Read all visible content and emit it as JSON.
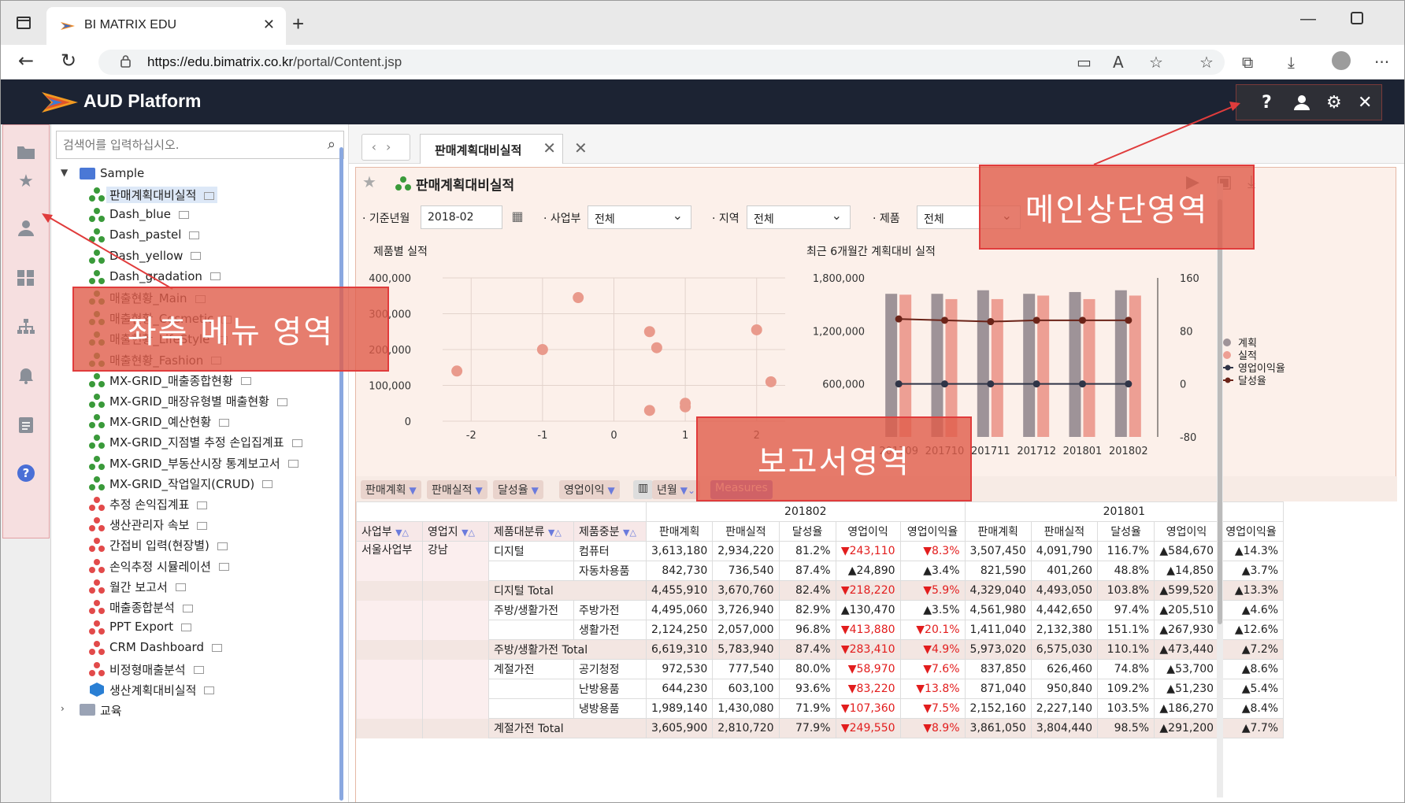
{
  "browser": {
    "tab_title": "BI MATRIX EDU",
    "url_host": "https://edu.bimatrix.co.kr",
    "url_path": "/portal/Content.jsp"
  },
  "app": {
    "name": "AUD Platform",
    "header_tools": [
      "help-icon",
      "user-icon",
      "gear-icon",
      "close-icon"
    ]
  },
  "sidebar_icons": [
    "folder-icon",
    "star-icon",
    "user-icon",
    "dashboard-icon",
    "org-chart-icon",
    "alarm-icon",
    "clipboard-icon",
    "help-icon"
  ],
  "search": {
    "placeholder": "검색어를 입력하십시오."
  },
  "tree": {
    "root": "Sample",
    "items": [
      {
        "label": "판매계획대비실적",
        "type": "green"
      },
      {
        "label": "Dash_blue",
        "type": "green"
      },
      {
        "label": "Dash_pastel",
        "type": "green"
      },
      {
        "label": "Dash_yellow",
        "type": "green"
      },
      {
        "label": "Dash_gradation",
        "type": "green"
      },
      {
        "label": "매출현황_Main",
        "type": "green"
      },
      {
        "label": "매출현황_Cosmetic",
        "type": "green"
      },
      {
        "label": "매출현황_LifeStyle",
        "type": "green"
      },
      {
        "label": "매출현황_Fashion",
        "type": "green"
      },
      {
        "label": "MX-GRID_매출종합현황",
        "type": "green"
      },
      {
        "label": "MX-GRID_매장유형별 매출현황",
        "type": "green"
      },
      {
        "label": "MX-GRID_예산현황",
        "type": "green"
      },
      {
        "label": "MX-GRID_지점별 추정 손입집계표",
        "type": "green"
      },
      {
        "label": "MX-GRID_부동산시장 통계보고서",
        "type": "green"
      },
      {
        "label": "MX-GRID_작업일지(CRUD)",
        "type": "green"
      },
      {
        "label": "추정 손익집계표",
        "type": "red"
      },
      {
        "label": "생산관리자 속보",
        "type": "red"
      },
      {
        "label": "간접비 입력(현장별)",
        "type": "red"
      },
      {
        "label": "손익추정 시뮬레이션",
        "type": "red"
      },
      {
        "label": "월간 보고서",
        "type": "red"
      },
      {
        "label": "매출종합분석",
        "type": "red"
      },
      {
        "label": "PPT Export",
        "type": "red"
      },
      {
        "label": "CRM Dashboard",
        "type": "red"
      },
      {
        "label": "비정형매출분석",
        "type": "red"
      },
      {
        "label": "생산계획대비실적",
        "type": "blue"
      }
    ],
    "next_folder": "교육"
  },
  "content": {
    "tab_label": "판매계획대비실적",
    "report_title": "판매계획대비실적",
    "filters": {
      "period_label": "· 기준년월",
      "period_value": "2018-02",
      "division_label": "· 사업부",
      "division_value": "전체",
      "region_label": "· 지역",
      "region_value": "전체",
      "product_label": "· 제품",
      "product_value": "전체"
    }
  },
  "chart_data": [
    {
      "type": "scatter",
      "title": "제품별 실적",
      "xlim": [
        -2.4,
        2.4
      ],
      "ylim": [
        0,
        400000
      ],
      "x_ticks": [
        -2,
        -1,
        0,
        1,
        2
      ],
      "y_ticks": [
        "0",
        "100,000",
        "200,000",
        "300,000",
        "400,000"
      ],
      "points": [
        [
          -2.2,
          140000
        ],
        [
          -1.0,
          200000
        ],
        [
          -0.5,
          345000
        ],
        [
          0.5,
          250000
        ],
        [
          0.6,
          205000
        ],
        [
          0.5,
          30000
        ],
        [
          1.0,
          40000
        ],
        [
          1.0,
          50000
        ],
        [
          2.0,
          255000
        ],
        [
          2.2,
          110000
        ]
      ]
    },
    {
      "type": "bar",
      "title": "최근 6개월간 계획대비 실적",
      "categories": [
        "201709",
        "201710",
        "201711",
        "201712",
        "201801",
        "201802"
      ],
      "ylim": [
        0,
        1800000
      ],
      "y_ticks": [
        "600,000",
        "1,200,000",
        "1,800,000"
      ],
      "y2lim": [
        -80,
        160
      ],
      "y2_ticks": [
        "-80",
        "0",
        "80",
        "160"
      ],
      "series": [
        {
          "name": "계획",
          "values": [
            1620000,
            1620000,
            1660000,
            1620000,
            1640000,
            1660000
          ],
          "color": "#9e9398"
        },
        {
          "name": "실적",
          "values": [
            1610000,
            1560000,
            1560000,
            1600000,
            1560000,
            1600000
          ],
          "color": "#ed9f94"
        },
        {
          "name": "영업이익율",
          "values": [
            0,
            0,
            0,
            0,
            0,
            0
          ],
          "axis": "right",
          "color": "#2f3447"
        },
        {
          "name": "달성율",
          "values": [
            98,
            96,
            94,
            96,
            96,
            96
          ],
          "axis": "right",
          "color": "#6b2318"
        }
      ]
    }
  ],
  "pivot": {
    "chips": [
      "판매계획",
      "판매실적",
      "달성율",
      "영업이익"
    ],
    "column_chip": "년월",
    "measures_chip": "Measures",
    "periods": [
      "201802",
      "201801"
    ],
    "row_headers": [
      "사업부",
      "영업지",
      "제품대분류",
      "제품중분"
    ],
    "measures": [
      "판매계획",
      "판매실적",
      "달성율",
      "영업이익",
      "영업이익율"
    ],
    "rows": [
      {
        "c1": "서울사업부",
        "c2": "강남",
        "c3": "디지털",
        "c4": "컴퓨터",
        "v": [
          "3,613,180",
          "2,934,220",
          "81.2%",
          "▼243,110",
          "▼8.3%",
          "3,507,450",
          "4,091,790",
          "116.7%",
          "▲584,670",
          "▲14.3%"
        ]
      },
      {
        "c1": "",
        "c2": "",
        "c3": "",
        "c4": "자동차용품",
        "v": [
          "842,730",
          "736,540",
          "87.4%",
          "▲24,890",
          "▲3.4%",
          "821,590",
          "401,260",
          "48.8%",
          "▲14,850",
          "▲3.7%"
        ]
      },
      {
        "c1": "",
        "c2": "",
        "c3": "디지털 Total",
        "c4": "",
        "tot": true,
        "v": [
          "4,455,910",
          "3,670,760",
          "82.4%",
          "▼218,220",
          "▼5.9%",
          "4,329,040",
          "4,493,050",
          "103.8%",
          "▲599,520",
          "▲13.3%"
        ]
      },
      {
        "c1": "",
        "c2": "",
        "c3": "주방/생활가전",
        "c4": "주방가전",
        "v": [
          "4,495,060",
          "3,726,940",
          "82.9%",
          "▲130,470",
          "▲3.5%",
          "4,561,980",
          "4,442,650",
          "97.4%",
          "▲205,510",
          "▲4.6%"
        ]
      },
      {
        "c1": "",
        "c2": "",
        "c3": "",
        "c4": "생활가전",
        "v": [
          "2,124,250",
          "2,057,000",
          "96.8%",
          "▼413,880",
          "▼20.1%",
          "1,411,040",
          "2,132,380",
          "151.1%",
          "▲267,930",
          "▲12.6%"
        ]
      },
      {
        "c1": "",
        "c2": "",
        "c3": "주방/생활가전 Total",
        "c4": "",
        "tot": true,
        "v": [
          "6,619,310",
          "5,783,940",
          "87.4%",
          "▼283,410",
          "▼4.9%",
          "5,973,020",
          "6,575,030",
          "110.1%",
          "▲473,440",
          "▲7.2%"
        ]
      },
      {
        "c1": "",
        "c2": "",
        "c3": "계절가전",
        "c4": "공기청정",
        "v": [
          "972,530",
          "777,540",
          "80.0%",
          "▼58,970",
          "▼7.6%",
          "837,850",
          "626,460",
          "74.8%",
          "▲53,700",
          "▲8.6%"
        ]
      },
      {
        "c1": "",
        "c2": "",
        "c3": "",
        "c4": "난방용품",
        "v": [
          "644,230",
          "603,100",
          "93.6%",
          "▼83,220",
          "▼13.8%",
          "871,040",
          "950,840",
          "109.2%",
          "▲51,230",
          "▲5.4%"
        ]
      },
      {
        "c1": "",
        "c2": "",
        "c3": "",
        "c4": "냉방용품",
        "v": [
          "1,989,140",
          "1,430,080",
          "71.9%",
          "▼107,360",
          "▼7.5%",
          "2,152,160",
          "2,227,140",
          "103.5%",
          "▲186,270",
          "▲8.4%"
        ]
      },
      {
        "c1": "",
        "c2": "",
        "c3": "계절가전 Total",
        "c4": "",
        "tot": true,
        "v": [
          "3,605,900",
          "2,810,720",
          "77.9%",
          "▼249,550",
          "▼8.9%",
          "3,861,050",
          "3,804,440",
          "98.5%",
          "▲291,200",
          "▲7.7%"
        ]
      }
    ]
  },
  "annotations": {
    "left_menu": "좌측 메뉴 영역",
    "top_main": "메인상단영역",
    "report": "보고서영역"
  },
  "colors": {
    "header_bg": "#1c2333",
    "report_bg": "#fcf0ea",
    "annotation": "#e05c4a"
  }
}
